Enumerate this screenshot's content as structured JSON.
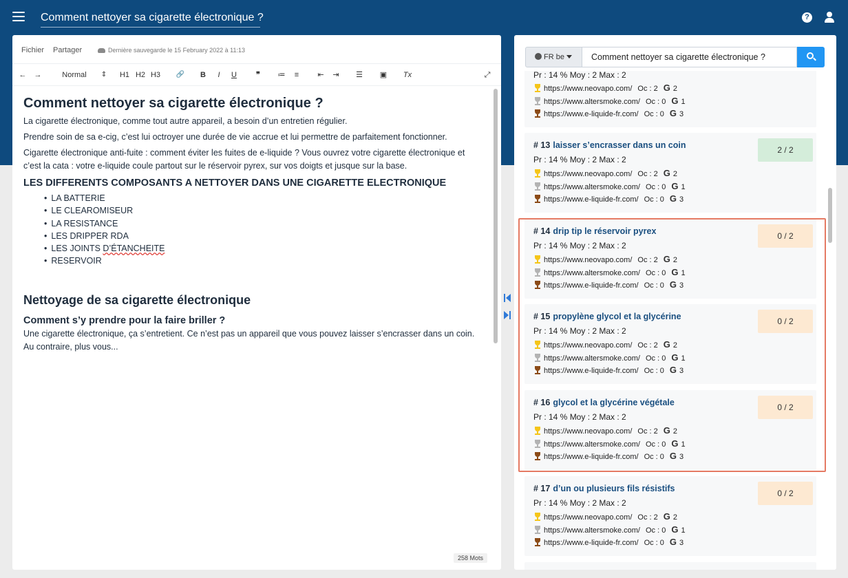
{
  "header": {
    "menu_icon": "hamburger-icon",
    "title": "Comment nettoyer sa cigarette électronique ?",
    "help_icon": "question-circle-icon",
    "user_icon": "user-icon",
    "help_glyph": "?"
  },
  "editor": {
    "menu": [
      "Fichier",
      "Partager"
    ],
    "save_status": "Dernière sauvegarde le 15 February 2022 à 11:13",
    "toolbar": {
      "undo": "←",
      "redo": "→",
      "format": "Normal",
      "format_caret": "⇕",
      "h1": "H1",
      "h2": "H2",
      "h3": "H3",
      "link": "🔗",
      "bold": "B",
      "italic": "I",
      "underline": "U",
      "quote": "❞",
      "ordered_list": "≔",
      "bullet_list": "≡",
      "outdent": "⇤",
      "indent": "⇥",
      "align": "☰",
      "image": "▣",
      "clear": "Tx",
      "fullscreen": "⤢"
    },
    "content": {
      "h1": "Comment nettoyer sa cigarette électronique ?",
      "p1": "La cigarette électronique, comme tout autre appareil, a besoin d’un entretien régulier.",
      "p2": "Prendre soin de sa e-cig, c’est lui octroyer une durée de vie accrue et lui permettre de parfaitement fonctionner.",
      "p3": "Cigarette électronique anti-fuite : comment éviter les fuites de e-liquide ? Vous ouvrez votre cigarette électronique et c’est la cata : votre e-liquide coule partout sur le réservoir pyrex, sur vos doigts et jusque sur la base.",
      "h3": "LES DIFFERENTS COMPOSANTS A NETTOYER DANS UNE CIGARETTE ELECTRONIQUE",
      "items": [
        "LA BATTERIE",
        "LE CLEAROMISEUR",
        "LA RESISTANCE",
        "LES DRIPPER RDA"
      ],
      "item5_prefix": "LES JOINTS ",
      "item5_wavy": "D’ÉTANCHEITE",
      "item6": "RESERVOIR",
      "h2": "Nettoyage de sa cigarette électronique",
      "h4": "Comment s’y prendre pour la faire briller ?",
      "p4": "Une cigarette électronique, ça s’entretient. Ce n’est pas un appareil que vous pouvez laisser s’encrasser dans un coin. Au contraire, plus vous..."
    },
    "word_count": "258 Mots"
  },
  "search": {
    "lang": "FR be",
    "query": "Comment nettoyer sa cigarette électronique ?"
  },
  "results": {
    "partial": {
      "stats": "Pr : 14 %   Moy : 2   Max : 2",
      "rows": [
        {
          "url": "https://www.neovapo.com/",
          "oc": "Oc : 2",
          "g": "2"
        },
        {
          "url": "https://www.altersmoke.com/",
          "oc": "Oc : 0",
          "g": "1"
        },
        {
          "url": "https://www.e-liquide-fr.com/",
          "oc": "Oc : 0",
          "g": "3"
        }
      ]
    },
    "cards": [
      {
        "num": "# 13",
        "kw": "laisser s’encrasser dans un coin",
        "badge": "2 / 2",
        "status": "ok",
        "stats": "Pr : 14 %   Moy : 2   Max : 2",
        "rows": [
          {
            "url": "https://www.neovapo.com/",
            "oc": "Oc : 2",
            "g": "2"
          },
          {
            "url": "https://www.altersmoke.com/",
            "oc": "Oc : 0",
            "g": "1"
          },
          {
            "url": "https://www.e-liquide-fr.com/",
            "oc": "Oc : 0",
            "g": "3"
          }
        ]
      },
      {
        "num": "# 14",
        "kw": "drip tip le réservoir pyrex",
        "badge": "0 / 2",
        "status": "todo",
        "stats": "Pr : 14 %   Moy : 2   Max : 2",
        "rows": [
          {
            "url": "https://www.neovapo.com/",
            "oc": "Oc : 2",
            "g": "2"
          },
          {
            "url": "https://www.altersmoke.com/",
            "oc": "Oc : 0",
            "g": "1"
          },
          {
            "url": "https://www.e-liquide-fr.com/",
            "oc": "Oc : 0",
            "g": "3"
          }
        ]
      },
      {
        "num": "# 15",
        "kw": "propylène glycol et la glycérine",
        "badge": "0 / 2",
        "status": "todo",
        "stats": "Pr : 14 %   Moy : 2   Max : 2",
        "rows": [
          {
            "url": "https://www.neovapo.com/",
            "oc": "Oc : 2",
            "g": "2"
          },
          {
            "url": "https://www.altersmoke.com/",
            "oc": "Oc : 0",
            "g": "1"
          },
          {
            "url": "https://www.e-liquide-fr.com/",
            "oc": "Oc : 0",
            "g": "3"
          }
        ]
      },
      {
        "num": "# 16",
        "kw": "glycol et la glycérine végétale",
        "badge": "0 / 2",
        "status": "todo",
        "stats": "Pr : 14 %   Moy : 2   Max : 2",
        "rows": [
          {
            "url": "https://www.neovapo.com/",
            "oc": "Oc : 2",
            "g": "2"
          },
          {
            "url": "https://www.altersmoke.com/",
            "oc": "Oc : 0",
            "g": "1"
          },
          {
            "url": "https://www.e-liquide-fr.com/",
            "oc": "Oc : 0",
            "g": "3"
          }
        ]
      },
      {
        "num": "# 17",
        "kw": "d’un ou plusieurs fils résistifs",
        "badge": "0 / 2",
        "status": "todo",
        "stats": "Pr : 14 %   Moy : 2   Max : 2",
        "rows": [
          {
            "url": "https://www.neovapo.com/",
            "oc": "Oc : 2",
            "g": "2"
          },
          {
            "url": "https://www.altersmoke.com/",
            "oc": "Oc : 0",
            "g": "1"
          },
          {
            "url": "https://www.e-liquide-fr.com/",
            "oc": "Oc : 0",
            "g": "3"
          }
        ]
      }
    ]
  },
  "colors": {
    "header_bg": "#0e4a7e",
    "accent": "#2196f3",
    "badge_ok": "#d4edda",
    "badge_todo": "#fde9d2",
    "highlight": "#e57a63"
  }
}
